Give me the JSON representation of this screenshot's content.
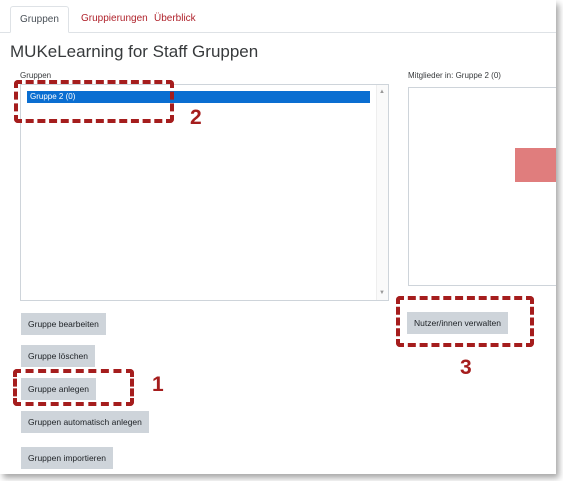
{
  "tabs": [
    {
      "label": "Gruppen"
    },
    {
      "label": "Gruppierungen"
    },
    {
      "label": "Überblick"
    }
  ],
  "page_title": "MUKeLearning for Staff Gruppen",
  "groups": {
    "label": "Gruppen",
    "items": [
      {
        "label": "Gruppe 2 (0)",
        "selected": true
      }
    ]
  },
  "members": {
    "label": "Mitglieder in: Gruppe 2 (0)"
  },
  "buttons": {
    "edit_group": "Gruppe bearbeiten",
    "delete_group": "Gruppe löschen",
    "create_group": "Gruppe anlegen",
    "auto_create": "Gruppen automatisch anlegen",
    "import_groups": "Gruppen importieren",
    "manage_users": "Nutzer/innen verwalten"
  },
  "annotations": {
    "one": "1",
    "two": "2",
    "three": "3"
  },
  "colors": {
    "accent": "#b0232c",
    "selection": "#0a6ed1",
    "button_bg": "#ced4da",
    "annotation": "#a51d1d"
  }
}
